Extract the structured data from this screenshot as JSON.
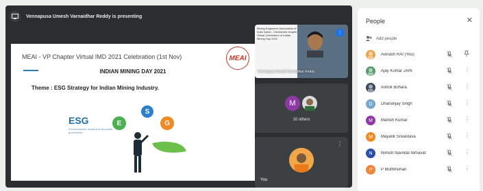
{
  "presenting": {
    "text": "Vennapusa Umesh Varnaidhar Reddy is presenting"
  },
  "slide": {
    "title": "MEAI - VP Chapter Virtual IMD 2021 Celebration (1st Nov)",
    "logo_text": "MEAI",
    "heading": "INDIAN MINING DAY 2021",
    "theme_label": "Theme :",
    "theme_value": "ESG Strategy for Indian Mining Industry.",
    "esg_title": "ESG",
    "esg_subtitle": "Environmental, social and corporate governance",
    "letters": {
      "e": "E",
      "s": "S",
      "g": "G"
    }
  },
  "tiles": {
    "speaker": {
      "name": "Vennapusa Umesh Varnaidhar Reddy",
      "minislide_text": "Mining Engineers' Association of India\nIndian - Vinchariam chapter\nVirtual Celebration of\nIndian Mining Day 2021"
    },
    "others": {
      "label": "10 others",
      "avatar_letter": "M"
    },
    "you": {
      "label": "You"
    }
  },
  "people": {
    "title": "People",
    "add_label": "Add people",
    "list": [
      {
        "name": "Avinash RAI (You)",
        "letter": "",
        "color": "#e8a54b",
        "pin": true
      },
      {
        "name": "Ajay Kumar JAIN",
        "letter": "",
        "color": "#5a9a6e",
        "pin": false
      },
      {
        "name": "Ashok Bohara",
        "letter": "",
        "color": "#3d4a5c",
        "pin": false
      },
      {
        "name": "Dhananjay Singh",
        "letter": "D",
        "color": "#7aa6c8",
        "pin": false
      },
      {
        "name": "Manish Kumar",
        "letter": "M",
        "color": "#8e3aa5",
        "pin": false
      },
      {
        "name": "Mayank Srivastava",
        "letter": "M",
        "color": "#f08a24",
        "pin": false
      },
      {
        "name": "Nimish Navnital Nimavat",
        "letter": "N",
        "color": "#2b4fa8",
        "pin": false
      },
      {
        "name": "P Muthmohan",
        "letter": "P",
        "color": "#f0853a",
        "pin": false
      }
    ]
  },
  "colors": {
    "accent_blue": "#1a73e8",
    "stage": "#2b2d30",
    "tile": "#3c4043"
  }
}
